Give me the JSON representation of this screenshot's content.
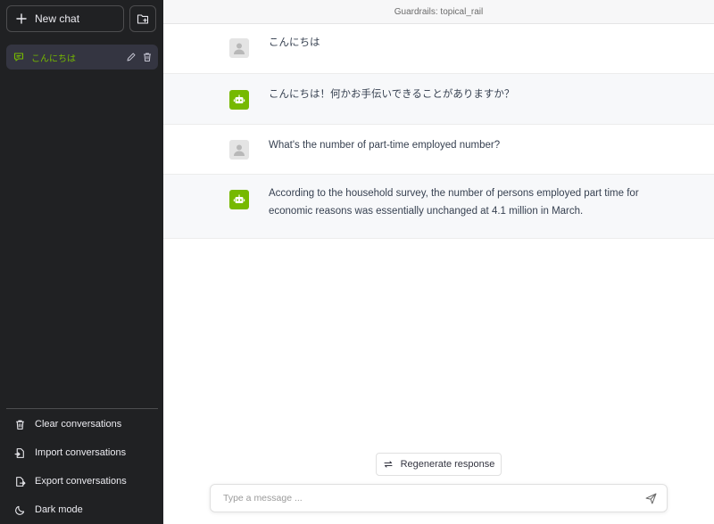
{
  "sidebar": {
    "new_chat_label": "New chat",
    "conversations": [
      {
        "label": "こんにちは"
      }
    ],
    "bottom_items": [
      {
        "label": "Clear conversations",
        "icon": "trash-icon"
      },
      {
        "label": "Import conversations",
        "icon": "file-import-icon"
      },
      {
        "label": "Export conversations",
        "icon": "file-export-icon"
      },
      {
        "label": "Dark mode",
        "icon": "moon-icon"
      }
    ]
  },
  "header": {
    "title": "Guardrails: topical_rail"
  },
  "messages": [
    {
      "role": "user",
      "text": "こんにちは"
    },
    {
      "role": "assistant",
      "text": "こんにちは！何かお手伝いできることがありますか？"
    },
    {
      "role": "user",
      "text": "What's the number of part-time employed number?"
    },
    {
      "role": "assistant",
      "text": "According to the household survey, the number of persons employed part time for economic reasons was essentially unchanged at 4.1 million in March."
    }
  ],
  "regenerate_label": "Regenerate response",
  "input": {
    "placeholder": "Type a message ...",
    "value": ""
  },
  "colors": {
    "accent": "#76b900",
    "sidebar_bg": "#202123",
    "selected_item_bg": "#343541"
  }
}
